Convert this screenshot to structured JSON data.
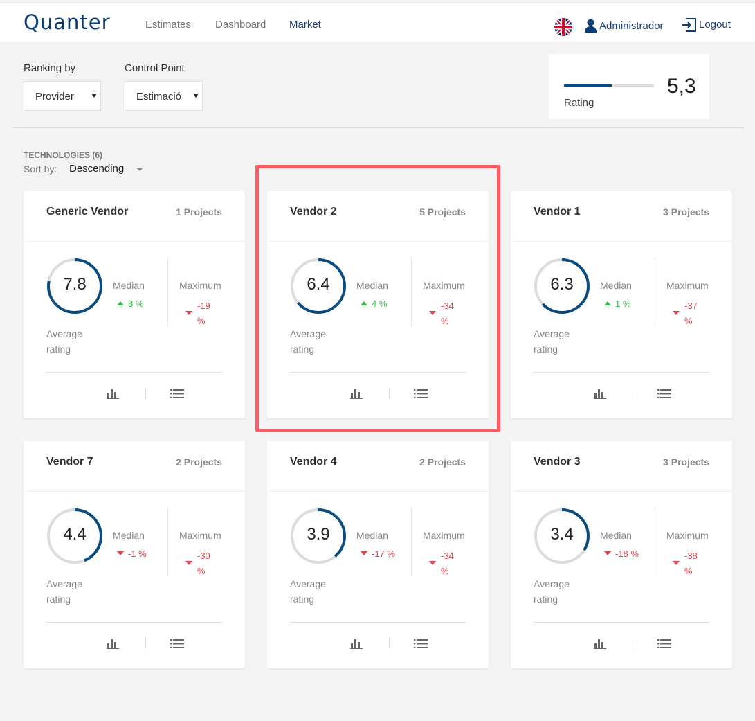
{
  "header": {
    "logo": "Quanter",
    "nav": [
      {
        "label": "Estimates"
      },
      {
        "label": "Dashboard"
      },
      {
        "label": "Market"
      }
    ],
    "user_label": "Administrador",
    "logout_label": "Logout"
  },
  "filters": {
    "ranking_label": "Ranking by",
    "ranking_value": "Provider",
    "control_label": "Control Point",
    "control_value": "Estimació"
  },
  "summary": {
    "rating_value": "5,3",
    "rating_label": "Rating",
    "rating_fraction": 0.53
  },
  "list": {
    "count_label": "TECHNOLOGIES (6)",
    "sort_label": "Sort by:",
    "sort_value": "Descending"
  },
  "labels": {
    "median": "Median",
    "maximum": "Maximum",
    "average": "Average rating"
  },
  "colors": {
    "accent": "#0b4c80",
    "up": "#3bb54a",
    "down": "#e0434b",
    "highlight": "#ff5b63"
  },
  "cards": [
    {
      "name": "Generic Vendor",
      "projects": "1 Projects",
      "rating": "7.8",
      "rating_num": 7.8,
      "median": "8 %",
      "median_dir": "up",
      "max": "-19 %"
    },
    {
      "name": "Vendor 2",
      "projects": "5 Projects",
      "rating": "6.4",
      "rating_num": 6.4,
      "median": "4 %",
      "median_dir": "up",
      "max": "-34 %"
    },
    {
      "name": "Vendor 1",
      "projects": "3 Projects",
      "rating": "6.3",
      "rating_num": 6.3,
      "median": "1 %",
      "median_dir": "up",
      "max": "-37 %"
    },
    {
      "name": "Vendor 7",
      "projects": "2 Projects",
      "rating": "4.4",
      "rating_num": 4.4,
      "median": "-1 %",
      "median_dir": "down",
      "max": "-30 %"
    },
    {
      "name": "Vendor 4",
      "projects": "2 Projects",
      "rating": "3.9",
      "rating_num": 3.9,
      "median": "-17 %",
      "median_dir": "down",
      "max": "-34 %"
    },
    {
      "name": "Vendor 3",
      "projects": "3 Projects",
      "rating": "3.4",
      "rating_num": 3.4,
      "median": "-18 %",
      "median_dir": "down",
      "max": "-38 %"
    }
  ]
}
